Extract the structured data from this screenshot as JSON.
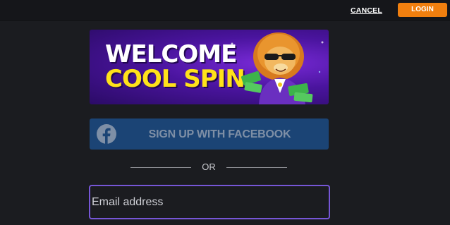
{
  "header": {
    "cancel_label": "CANCEL",
    "login_label": "LOGIN"
  },
  "banner": {
    "line1": "WELCOME",
    "line2": "COOL SPIN",
    "mascot_icon": "lion-with-sunglasses-icon"
  },
  "facebook": {
    "label": "SIGN UP WITH FACEBOOK",
    "icon": "facebook-icon"
  },
  "divider": {
    "text": "OR"
  },
  "email": {
    "placeholder": "Email address",
    "value": ""
  },
  "colors": {
    "accent": "#f07f0f",
    "facebook": "#1b4475",
    "focus_border": "#7656d6",
    "background": "#1b1c20"
  }
}
